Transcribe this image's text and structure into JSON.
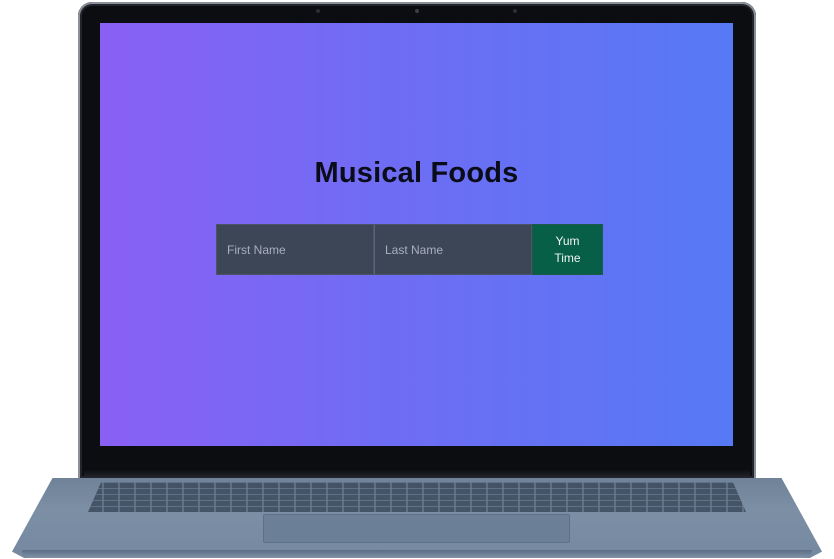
{
  "app": {
    "title": "Musical Foods"
  },
  "form": {
    "first_name_placeholder": "First Name",
    "last_name_placeholder": "Last Name",
    "submit_label": "Yum Time"
  },
  "colors": {
    "gradient_start": "#8a60f4",
    "gradient_end": "#5679f5",
    "input_bg": "#3d4657",
    "button_bg": "#075f47"
  }
}
